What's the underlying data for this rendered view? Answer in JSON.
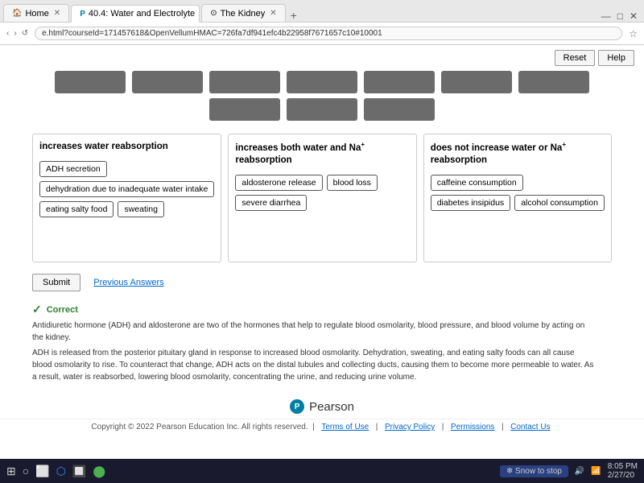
{
  "browser": {
    "tabs": [
      {
        "id": "home",
        "label": "Home",
        "icon": "🏠",
        "active": false
      },
      {
        "id": "water-electrolyte",
        "label": "40.4: Water and Electrolyte",
        "icon": "P",
        "active": true
      },
      {
        "id": "the-kidney",
        "label": "The Kidney",
        "icon": "⊙",
        "active": false
      }
    ],
    "address": "e.html?courseId=171457618&OpenVellumHMAC=726fa7df941efc4b22958f7671657c10#10001"
  },
  "toolbar": {
    "reset_label": "Reset",
    "help_label": "Help"
  },
  "drop_zones": {
    "row1_count": 7,
    "row2_count": 3
  },
  "columns": [
    {
      "id": "col1",
      "title": "increases water reabsorption",
      "tags": [
        "ADH secretion",
        "dehydration due to inadequate water intake",
        "eating salty food",
        "sweating"
      ]
    },
    {
      "id": "col2",
      "title": "increases both water and Na⁺ reabsorption",
      "tags": [
        "aldosterone release",
        "blood loss",
        "severe diarrhea"
      ]
    },
    {
      "id": "col3",
      "title": "does not increase water or Na⁺ reabsorption",
      "tags": [
        "caffeine consumption",
        "diabetes insipidus",
        "alcohol consumption"
      ]
    }
  ],
  "submit": {
    "submit_label": "Submit",
    "previous_answers_label": "Previous Answers"
  },
  "feedback": {
    "status": "Correct",
    "paragraph1": "Antidiuretic hormone (ADH) and aldosterone are two of the hormones that help to regulate blood osmolarity, blood pressure, and blood volume by acting on the kidney.",
    "paragraph2": "ADH is released from the posterior pituitary gland in response to increased blood osmolarity. Dehydration, sweating, and eating salty foods can all cause blood osmolarity to rise. To counteract that change, ADH acts on the distal tubules and collecting ducts, causing them to become more permeable to water. As a result, water is reabsorbed, lowering blood osmolarity, concentrating the urine, and reducing urine volume."
  },
  "pearson": {
    "logo_letter": "P",
    "brand_name": "Pearson"
  },
  "footer": {
    "copyright": "Copyright © 2022 Pearson Education Inc. All rights reserved.",
    "links": [
      "Terms of Use",
      "Privacy Policy",
      "Permissions",
      "Contact Us"
    ]
  },
  "taskbar": {
    "snow_label": "Snow to stop",
    "time": "8:05 PM",
    "date": "2/27/20"
  }
}
